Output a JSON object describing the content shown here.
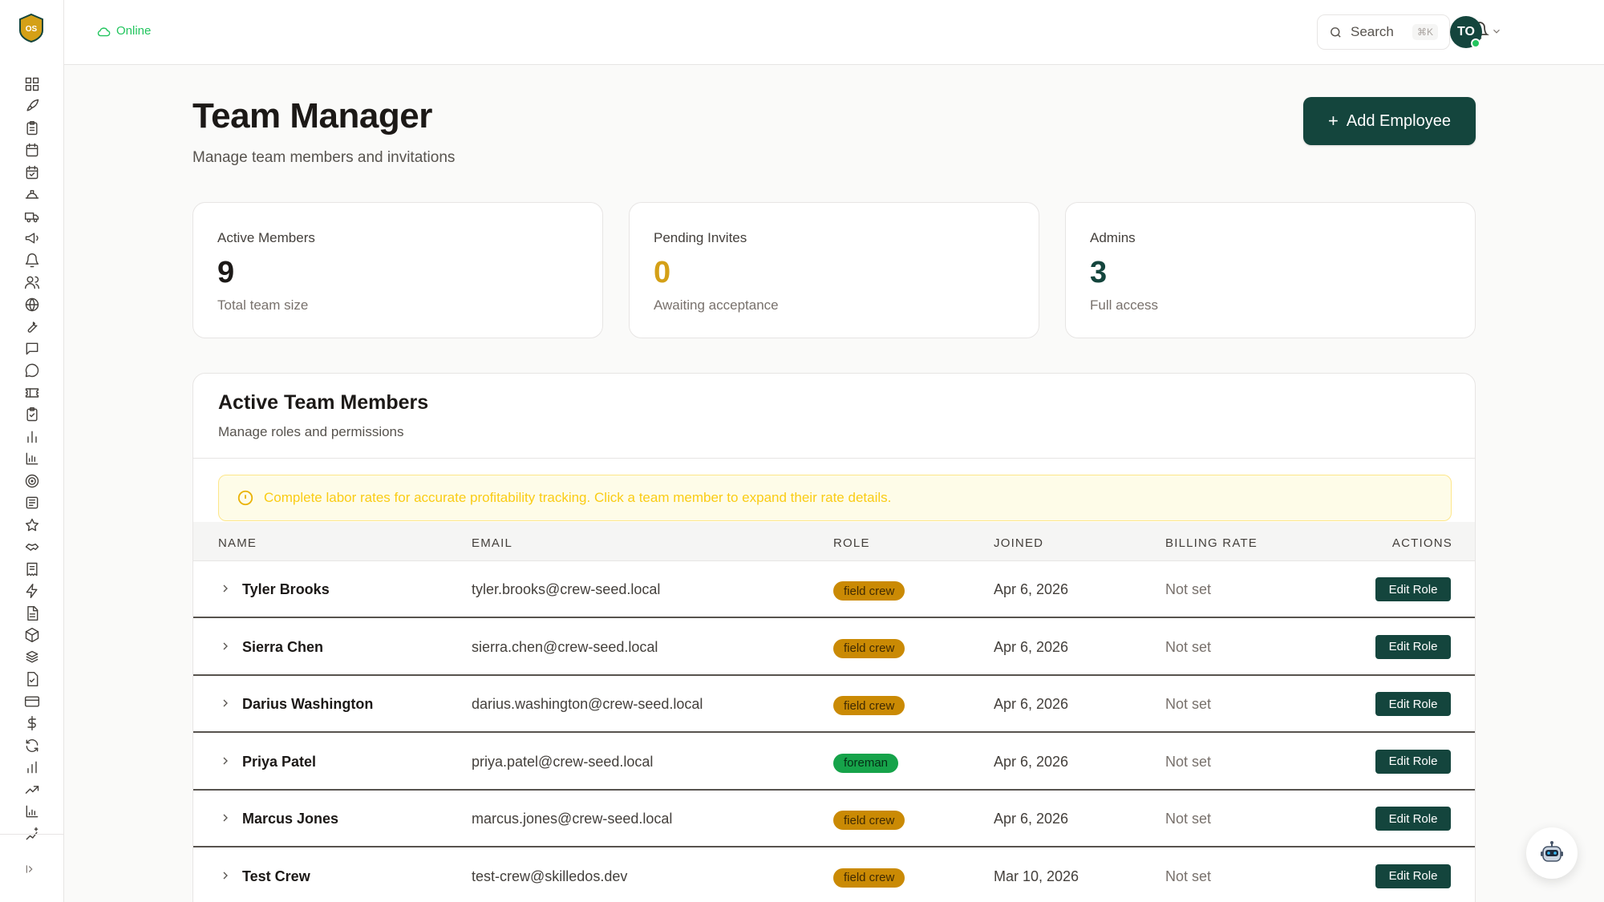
{
  "sidebar": {
    "logo_text": "OS",
    "icons": [
      "dashboard-icon",
      "rocket-icon",
      "clipboard-icon",
      "calendar-icon",
      "calendar-check-icon",
      "hard-hat-icon",
      "truck-icon",
      "megaphone-icon",
      "bell-icon",
      "users-icon",
      "globe-icon",
      "wrench-icon",
      "message-square-icon",
      "message-circle-icon",
      "ticket-icon",
      "clipboard-check-icon",
      "bar-chart-icon",
      "chart-icon",
      "target-icon",
      "newspaper-icon",
      "star-icon",
      "handshake-icon",
      "receipt-icon",
      "zap-icon",
      "file-text-icon",
      "package-icon",
      "boxes-icon",
      "file-check-icon",
      "credit-card-icon",
      "dollar-icon",
      "refresh-icon",
      "bar-chart-2-icon",
      "trending-up-icon",
      "chart-bar-icon",
      "sparkle-chart-icon"
    ],
    "collapse_icon": "collapse-icon"
  },
  "topbar": {
    "status": "Online",
    "search_label": "Search",
    "search_shortcut": "⌘K",
    "avatar_initials": "TO"
  },
  "header": {
    "title": "Team Manager",
    "subtitle": "Manage team members and invitations",
    "add_button": "Add Employee"
  },
  "stats": [
    {
      "label": "Active Members",
      "value": "9",
      "sub": "Total team size"
    },
    {
      "label": "Pending Invites",
      "value": "0",
      "sub": "Awaiting acceptance"
    },
    {
      "label": "Admins",
      "value": "3",
      "sub": "Full access"
    }
  ],
  "team": {
    "title": "Active Team Members",
    "subtitle": "Manage roles and permissions",
    "notice": "Complete labor rates for accurate profitability tracking. Click a team member to expand their rate details.",
    "columns": [
      "NAME",
      "EMAIL",
      "ROLE",
      "JOINED",
      "BILLING RATE",
      "ACTIONS"
    ],
    "rows": [
      {
        "name": "Tyler Brooks",
        "email": "tyler.brooks@crew-seed.local",
        "role": "field crew",
        "joined": "Apr 6, 2026",
        "rate": "Not set",
        "action": "Edit Role"
      },
      {
        "name": "Sierra Chen",
        "email": "sierra.chen@crew-seed.local",
        "role": "field crew",
        "joined": "Apr 6, 2026",
        "rate": "Not set",
        "action": "Edit Role"
      },
      {
        "name": "Darius Washington",
        "email": "darius.washington@crew-seed.local",
        "role": "field crew",
        "joined": "Apr 6, 2026",
        "rate": "Not set",
        "action": "Edit Role"
      },
      {
        "name": "Priya Patel",
        "email": "priya.patel@crew-seed.local",
        "role": "foreman",
        "joined": "Apr 6, 2026",
        "rate": "Not set",
        "action": "Edit Role"
      },
      {
        "name": "Marcus Jones",
        "email": "marcus.jones@crew-seed.local",
        "role": "field crew",
        "joined": "Apr 6, 2026",
        "rate": "Not set",
        "action": "Edit Role"
      },
      {
        "name": "Test Crew",
        "email": "test-crew@skilledos.dev",
        "role": "field crew",
        "joined": "Mar 10, 2026",
        "rate": "Not set",
        "action": "Edit Role"
      }
    ]
  },
  "colors": {
    "brand": "#14453d",
    "field_crew_badge": "#ca8a04",
    "foreman_badge": "#16a34a",
    "online": "#22c55e",
    "logo": "#d4a017"
  }
}
